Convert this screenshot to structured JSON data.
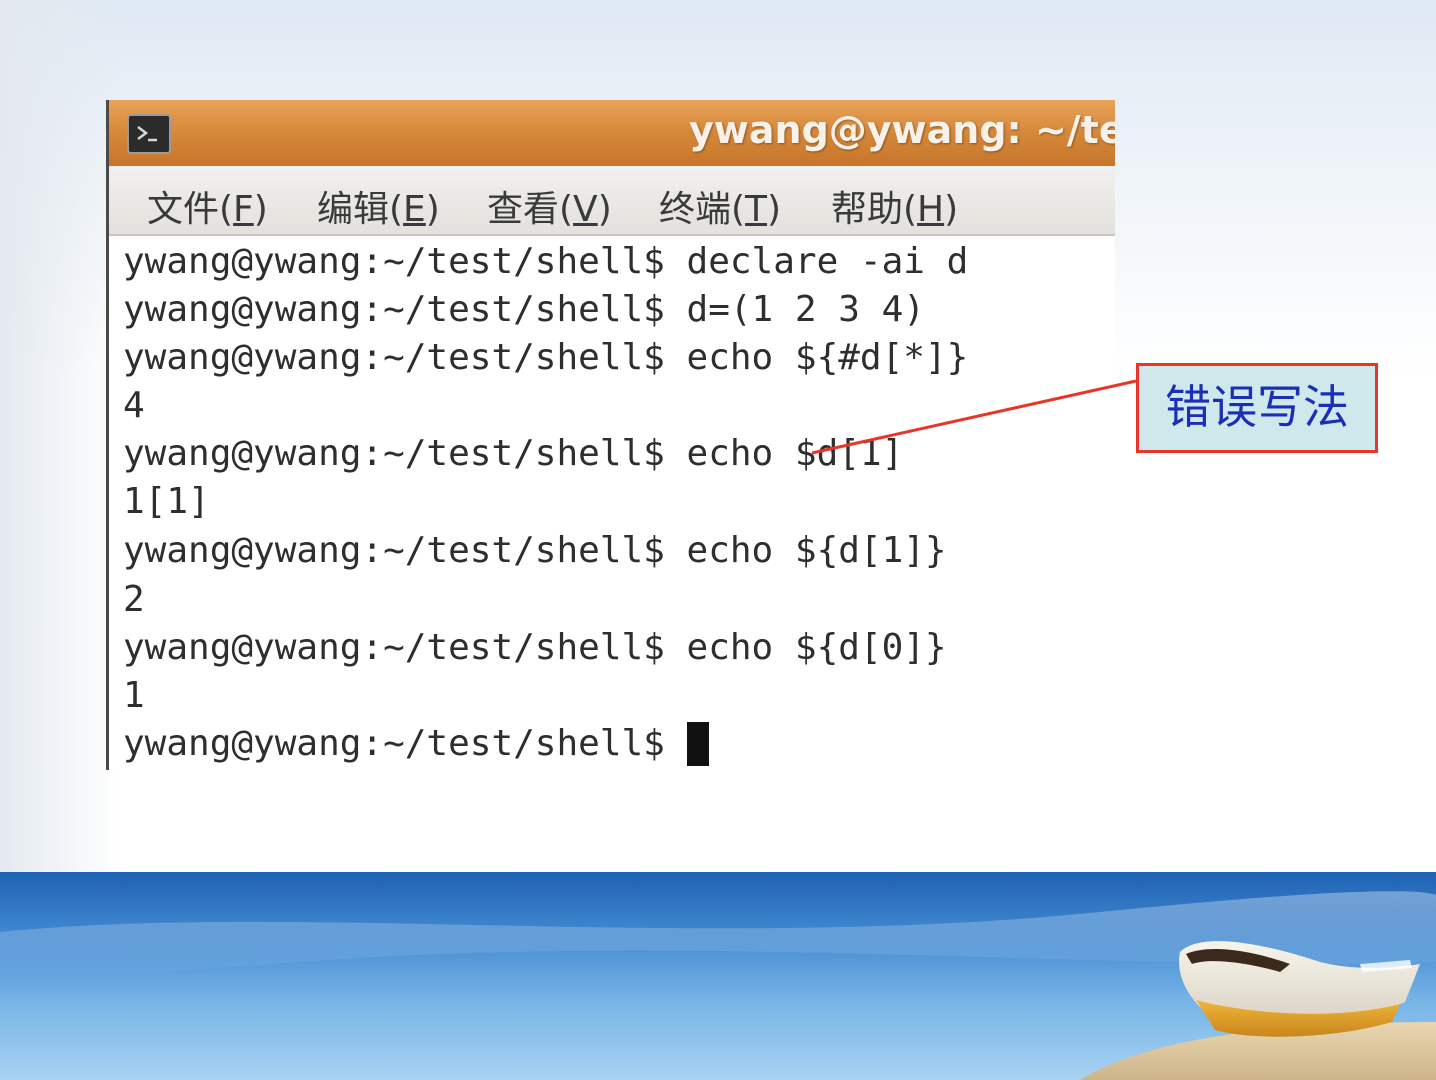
{
  "window": {
    "title": "ywang@ywang: ~/te"
  },
  "menu": {
    "items": [
      {
        "label": "文件(",
        "key": "F",
        "close": ")"
      },
      {
        "label": "编辑(",
        "key": "E",
        "close": ")"
      },
      {
        "label": "查看(",
        "key": "V",
        "close": ")"
      },
      {
        "label": "终端(",
        "key": "T",
        "close": ")"
      },
      {
        "label": "帮助(",
        "key": "H",
        "close": ")"
      }
    ]
  },
  "terminal": {
    "lines": [
      "ywang@ywang:~/test/shell$ declare -ai d",
      "ywang@ywang:~/test/shell$ d=(1 2 3 4)",
      "ywang@ywang:~/test/shell$ echo ${#d[*]}",
      "4",
      "ywang@ywang:~/test/shell$ echo $d[1]",
      "1[1]",
      "ywang@ywang:~/test/shell$ echo ${d[1]}",
      "2",
      "ywang@ywang:~/test/shell$ echo ${d[0]}",
      "1",
      "ywang@ywang:~/test/shell$ "
    ]
  },
  "callout": {
    "text": "错误写法"
  },
  "colors": {
    "titlebar": "#d78a3b",
    "callout_border": "#e8352a",
    "callout_fill": "#cfe8eb",
    "callout_text": "#1b2fb5"
  },
  "icons": {
    "terminal_app": "terminal-icon",
    "decoration": "boat-icon"
  }
}
